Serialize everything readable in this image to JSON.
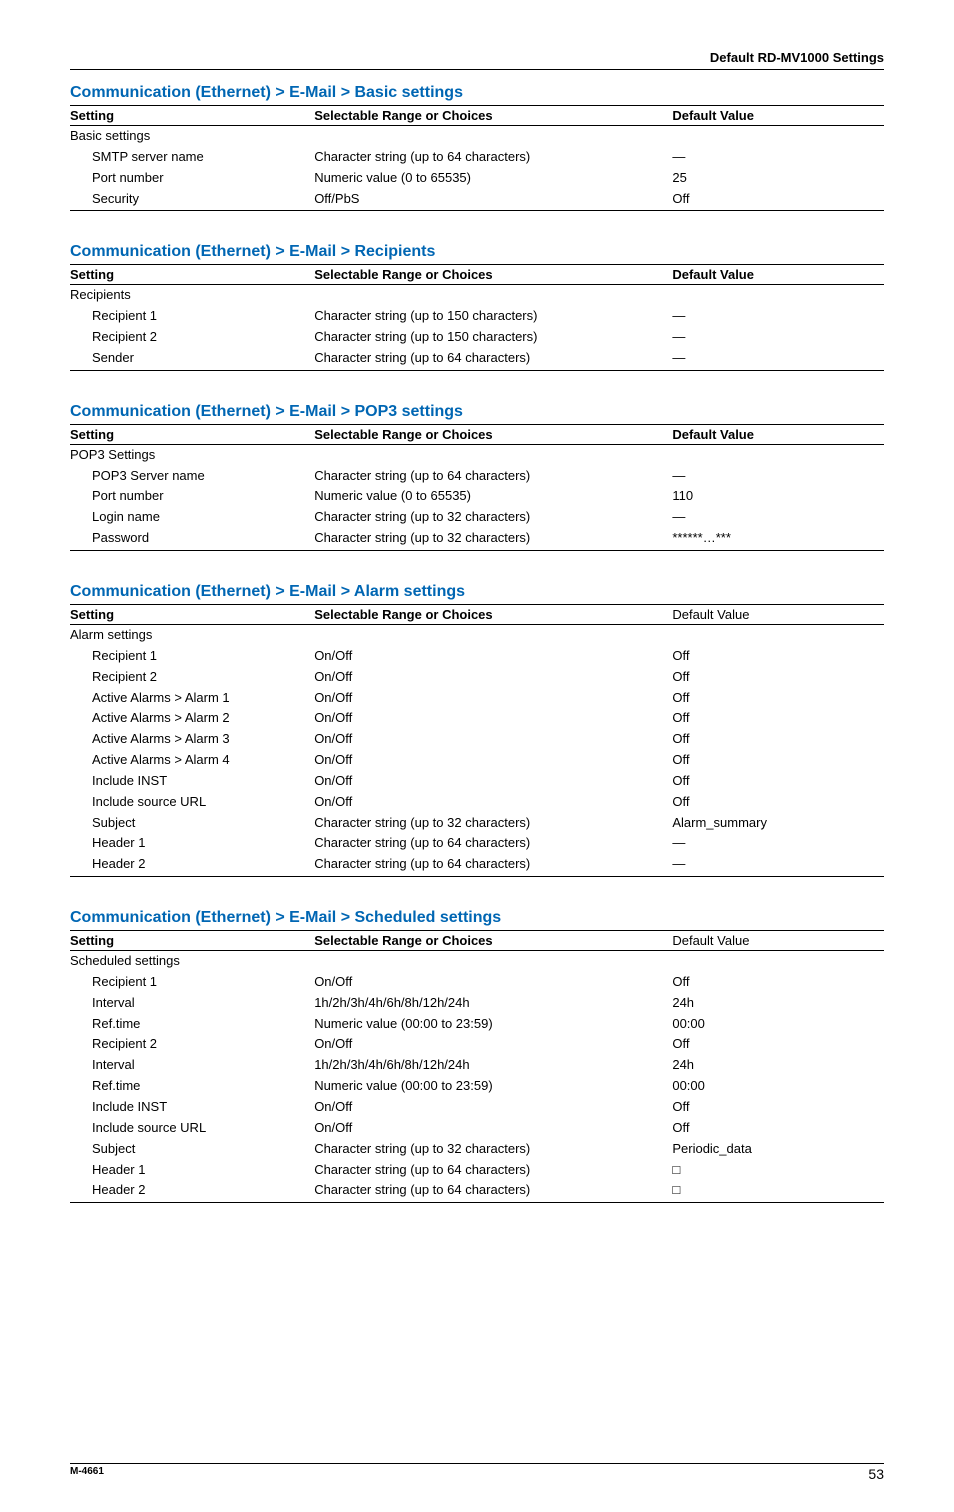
{
  "header": "Default RD-MV1000 Settings",
  "footer": {
    "doc_id": "M-4661",
    "page_no": "53"
  },
  "columns": {
    "setting": "Setting",
    "range": "Selectable Range or Choices",
    "default": "Default Value"
  },
  "sections": [
    {
      "title": "Communication (Ethernet) > E-Mail > Basic settings",
      "default_bold": true,
      "rows": [
        {
          "setting": "Basic settings",
          "range": "",
          "default": "",
          "group": true
        },
        {
          "setting": "SMTP server name",
          "range": "Character string (up to 64 characters)",
          "default": "—"
        },
        {
          "setting": "Port number",
          "range": "Numeric value (0 to 65535)",
          "default": "25"
        },
        {
          "setting": "Security",
          "range": "Off/PbS",
          "default": "Off"
        }
      ]
    },
    {
      "title": "Communication (Ethernet) > E-Mail > Recipients",
      "default_bold": true,
      "rows": [
        {
          "setting": "Recipients",
          "range": "",
          "default": "",
          "group": true
        },
        {
          "setting": "Recipient 1",
          "range": "Character string (up to 150 characters)",
          "default": "—"
        },
        {
          "setting": "Recipient 2",
          "range": "Character string (up to 150 characters)",
          "default": "—"
        },
        {
          "setting": "Sender",
          "range": "Character string (up to 64 characters)",
          "default": "—"
        }
      ]
    },
    {
      "title": "Communication (Ethernet) > E-Mail > POP3 settings",
      "default_bold": true,
      "rows": [
        {
          "setting": "POP3 Settings",
          "range": "",
          "default": "",
          "group": true
        },
        {
          "setting": "POP3 Server name",
          "range": "Character string (up to 64 characters)",
          "default": "—"
        },
        {
          "setting": "Port number",
          "range": "Numeric value (0 to 65535)",
          "default": "110"
        },
        {
          "setting": "Login name",
          "range": "Character string (up to 32 characters)",
          "default": "—"
        },
        {
          "setting": "Password",
          "range": "Character string (up to 32 characters)",
          "default": "******…***"
        }
      ]
    },
    {
      "title": "Communication (Ethernet) > E-Mail > Alarm settings",
      "default_bold": false,
      "rows": [
        {
          "setting": "Alarm settings",
          "range": "",
          "default": "",
          "group": true
        },
        {
          "setting": "Recipient 1",
          "range": "On/Off",
          "default": "Off"
        },
        {
          "setting": "Recipient 2",
          "range": "On/Off",
          "default": "Off"
        },
        {
          "setting": "Active Alarms > Alarm 1",
          "range": "On/Off",
          "default": "Off"
        },
        {
          "setting": "Active Alarms > Alarm 2",
          "range": "On/Off",
          "default": "Off"
        },
        {
          "setting": "Active Alarms > Alarm 3",
          "range": "On/Off",
          "default": "Off"
        },
        {
          "setting": "Active Alarms > Alarm 4",
          "range": "On/Off",
          "default": "Off"
        },
        {
          "setting": "Include INST",
          "range": "On/Off",
          "default": "Off"
        },
        {
          "setting": "Include source URL",
          "range": "On/Off",
          "default": "Off"
        },
        {
          "setting": "Subject",
          "range": "Character string (up to 32 characters)",
          "default": "Alarm_summary"
        },
        {
          "setting": "Header 1",
          "range": "Character string (up to 64 characters)",
          "default": "—"
        },
        {
          "setting": "Header 2",
          "range": "Character string (up to 64 characters)",
          "default": "—"
        }
      ]
    },
    {
      "title": "Communication (Ethernet) > E-Mail > Scheduled settings",
      "default_bold": false,
      "rows": [
        {
          "setting": "Scheduled settings",
          "range": "",
          "default": "",
          "group": true
        },
        {
          "setting": "Recipient 1",
          "range": "On/Off",
          "default": "Off"
        },
        {
          "setting": "Interval",
          "range": "1h/2h/3h/4h/6h/8h/12h/24h",
          "default": "24h"
        },
        {
          "setting": "Ref.time",
          "range": "Numeric value (00:00 to 23:59)",
          "default": "00:00"
        },
        {
          "setting": "Recipient 2",
          "range": "On/Off",
          "default": "Off"
        },
        {
          "setting": "Interval",
          "range": "1h/2h/3h/4h/6h/8h/12h/24h",
          "default": "24h"
        },
        {
          "setting": "Ref.time",
          "range": "Numeric value (00:00 to 23:59)",
          "default": "00:00"
        },
        {
          "setting": "Include INST",
          "range": "On/Off",
          "default": "Off"
        },
        {
          "setting": "Include source URL",
          "range": "On/Off",
          "default": "Off"
        },
        {
          "setting": "Subject",
          "range": "Character string (up to 32 characters)",
          "default": "Periodic_data"
        },
        {
          "setting": "Header 1",
          "range": "Character string (up to 64 characters)",
          "default": "□"
        },
        {
          "setting": "Header 2",
          "range": "Character string (up to 64 characters)",
          "default": "□"
        }
      ]
    }
  ]
}
